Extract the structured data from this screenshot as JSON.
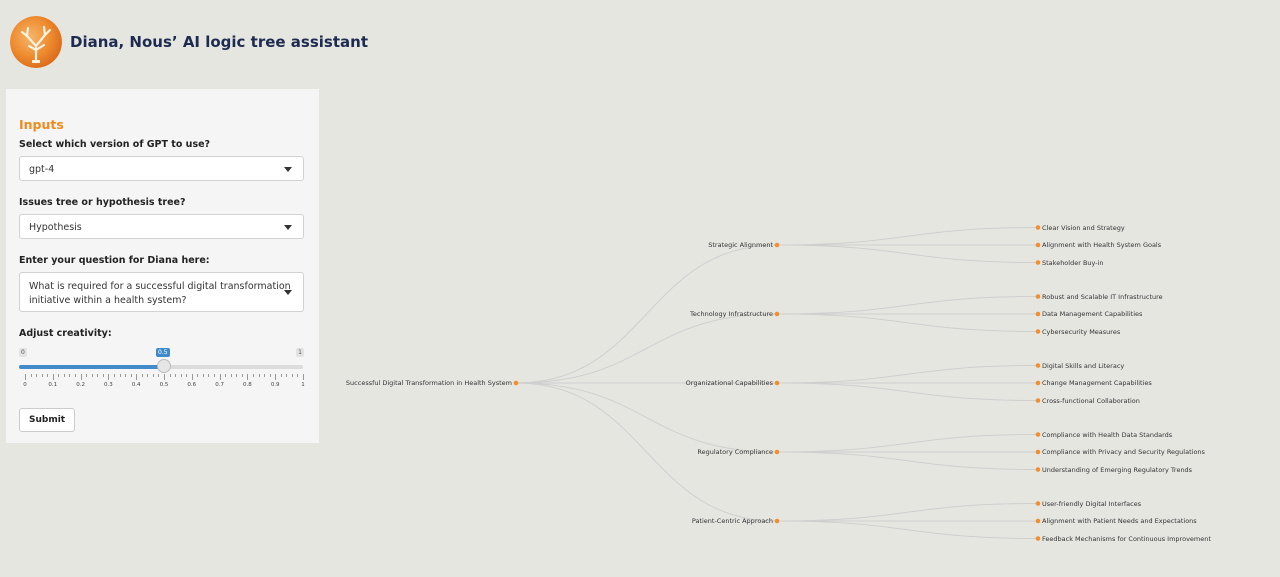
{
  "header": {
    "title": "Diana, Nous’ AI logic tree assistant"
  },
  "inputs": {
    "title": "Inputs",
    "gpt": {
      "label": "Select which version of GPT to use?",
      "value": "gpt-4"
    },
    "tree_type": {
      "label": "Issues tree or hypothesis tree?",
      "value": "Hypothesis"
    },
    "question": {
      "label": "Enter your question for Diana here:",
      "value_line1": "What is required for a successful digital transformation",
      "value_line2": "initiative within a health system?"
    },
    "creativity": {
      "label": "Adjust creativity:",
      "min_label": "0",
      "max_label": "1",
      "current_label": "0.5",
      "min": 0,
      "max": 1,
      "value": 0.5,
      "tick_labels": [
        "0",
        "0.1",
        "0.2",
        "0.3",
        "0.4",
        "0.5",
        "0.6",
        "0.7",
        "0.8",
        "0.9",
        "1"
      ]
    },
    "submit_label": "Submit"
  },
  "colors": {
    "accent": "#ef8a1d",
    "slider": "#428bca",
    "title": "#1d2b50",
    "node": "#f28e2b",
    "link": "#cfcfcf"
  },
  "tree": {
    "root": "Successful Digital Transformation in Health System",
    "branches": [
      {
        "label": "Strategic Alignment",
        "children": [
          "Clear Vision and Strategy",
          "Alignment with Health System Goals",
          "Stakeholder Buy-in"
        ]
      },
      {
        "label": "Technology Infrastructure",
        "children": [
          "Robust and Scalable IT Infrastructure",
          "Data Management Capabilities",
          "Cybersecurity Measures"
        ]
      },
      {
        "label": "Organizational Capabilities",
        "children": [
          "Digital Skills and Literacy",
          "Change Management Capabilities",
          "Cross-functional Collaboration"
        ]
      },
      {
        "label": "Regulatory Compliance",
        "children": [
          "Compliance with Health Data Standards",
          "Compliance with Privacy and Security Regulations",
          "Understanding of Emerging Regulatory Trends"
        ]
      },
      {
        "label": "Patient-Centric Approach",
        "children": [
          "User-friendly Digital Interfaces",
          "Alignment with Patient Needs and Expectations",
          "Feedback Mechanisms for Continuous Improvement"
        ]
      }
    ]
  }
}
